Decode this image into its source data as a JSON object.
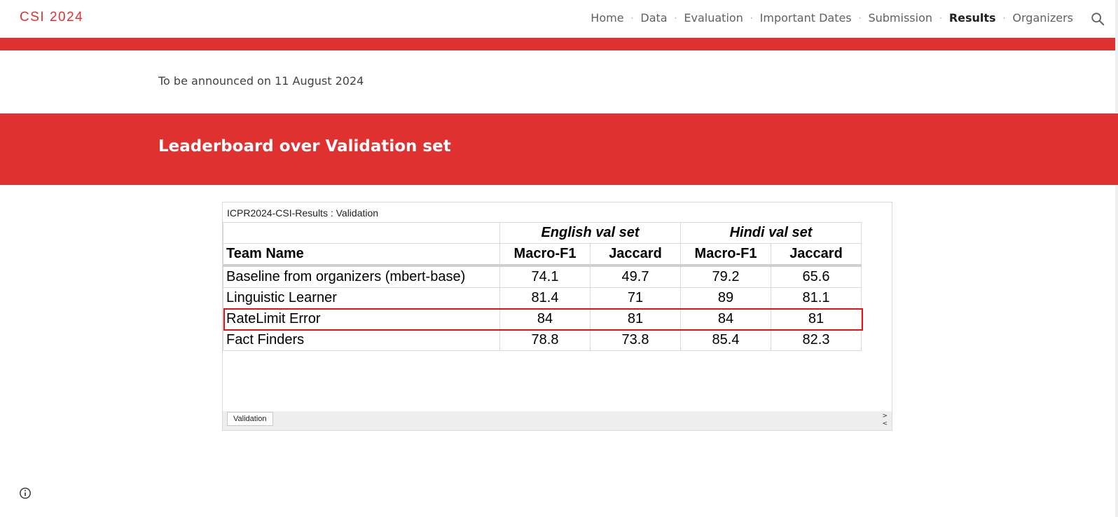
{
  "header": {
    "site_title": "CSI 2024",
    "nav": [
      {
        "label": "Home",
        "active": false
      },
      {
        "label": "Data",
        "active": false
      },
      {
        "label": "Evaluation",
        "active": false
      },
      {
        "label": "Important Dates",
        "active": false
      },
      {
        "label": "Submission",
        "active": false
      },
      {
        "label": "Results",
        "active": true
      },
      {
        "label": "Organizers",
        "active": false
      }
    ],
    "search_icon": "search-icon"
  },
  "main": {
    "announcement": "To be announced on 11 August 2024",
    "section_title": "Leaderboard over Validation set"
  },
  "sheet": {
    "title": "ICPR2024-CSI-Results : Validation",
    "group_headers": [
      "English val set",
      "Hindi val set"
    ],
    "column_headers": [
      "Team Name",
      "Macro-F1",
      "Jaccard",
      "Macro-F1",
      "Jaccard"
    ],
    "rows": [
      {
        "team": "Baseline from organizers (mbert-base)",
        "values": [
          "74.1",
          "49.7",
          "79.2",
          "65.6"
        ],
        "highlighted": false
      },
      {
        "team": "Linguistic Learner",
        "values": [
          "81.4",
          "71",
          "89",
          "81.1"
        ],
        "highlighted": false
      },
      {
        "team": "RateLimit Error",
        "values": [
          "84",
          "81",
          "84",
          "81"
        ],
        "highlighted": true
      },
      {
        "team": "Fact Finders",
        "values": [
          "78.8",
          "73.8",
          "85.4",
          "82.3"
        ],
        "highlighted": false
      }
    ],
    "tab_label": "Validation",
    "scroll_arrows": [
      ">",
      "<"
    ]
  },
  "colors": {
    "accent": "#e03131",
    "highlight_border": "#e8121a"
  }
}
